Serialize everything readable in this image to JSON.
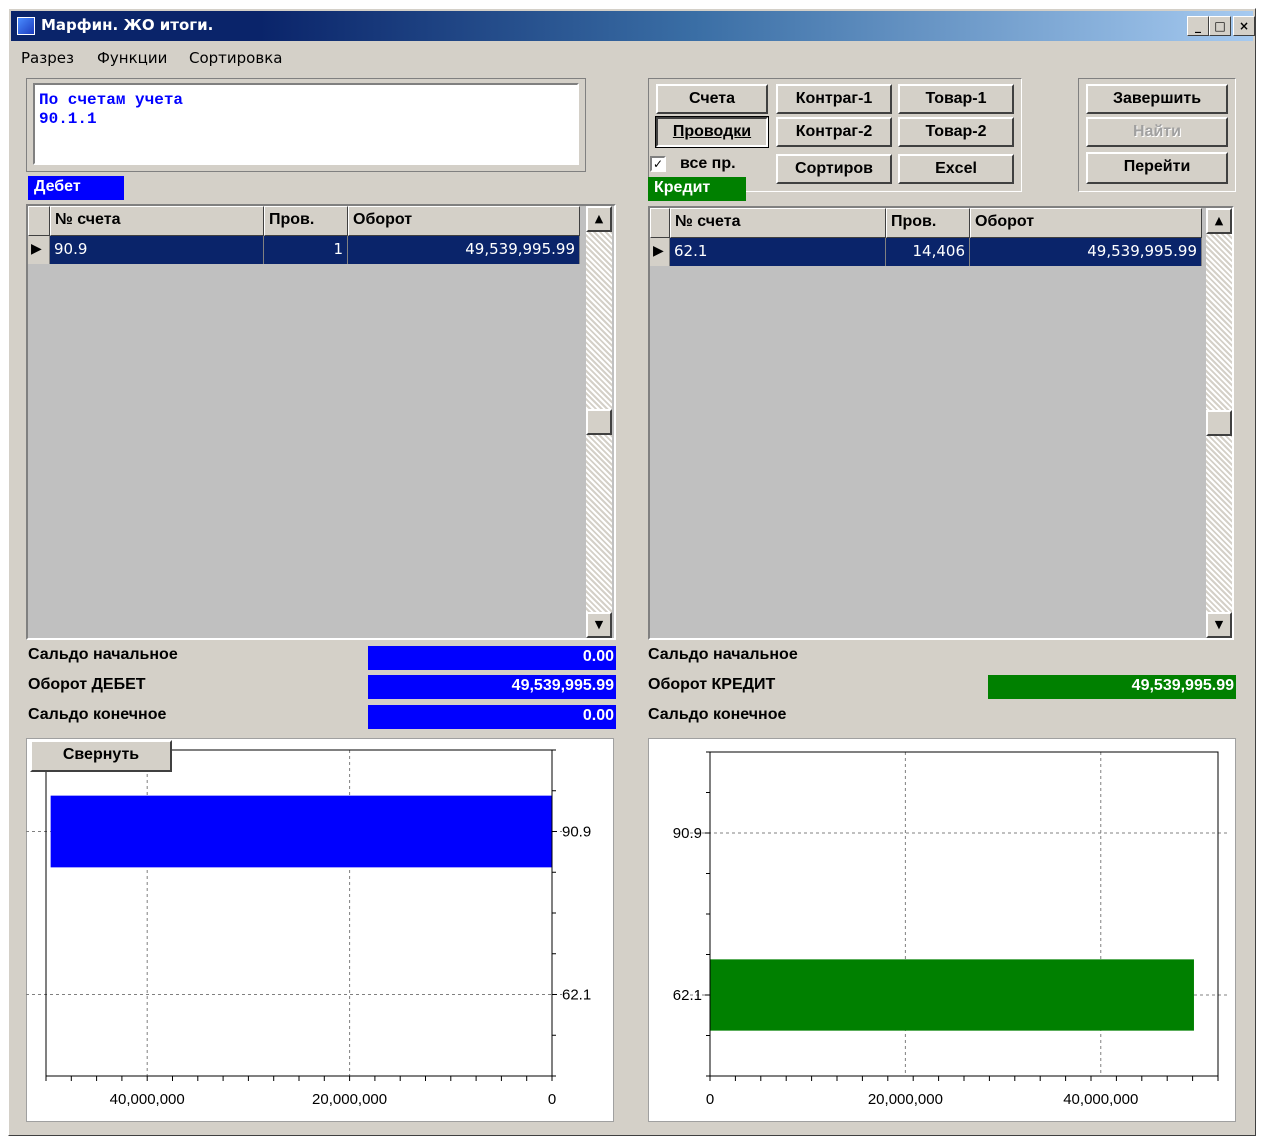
{
  "window": {
    "title": "Марфин. ЖО итоги.",
    "controls": {
      "minimize": "_",
      "maximize": "□",
      "close": "×"
    }
  },
  "menu": [
    "Разрез",
    "Функции",
    "Сортировка"
  ],
  "info_box": {
    "line1": "По счетам учета",
    "line2": "90.1.1"
  },
  "buttons": {
    "accounts": "Счета",
    "postings": "Проводки",
    "counterparty1": "Контраг-1",
    "counterparty2": "Контраг-2",
    "goods1": "Товар-1",
    "goods2": "Товар-2",
    "sort": "Сортиров",
    "excel": "Excel",
    "finish": "Завершить",
    "find": "Найти",
    "goto": "Перейти"
  },
  "checkbox": {
    "label": "все пр.",
    "checked": true,
    "mark": "✓"
  },
  "debit": {
    "caption": "Дебет",
    "color": "#0000ff",
    "columns": [
      "№ счета",
      "Пров.",
      "Оборот"
    ],
    "rows": [
      {
        "account": "90.9",
        "count": "1",
        "turnover": "49,539,995.99"
      }
    ],
    "summary": [
      {
        "label": "Сальдо начальное",
        "value": "0.00"
      },
      {
        "label": "Оборот ДЕБЕТ",
        "value": "49,539,995.99"
      },
      {
        "label": "Сальдо конечное",
        "value": "0.00"
      }
    ],
    "collapse_button": "Свернуть"
  },
  "credit": {
    "caption": "Кредит",
    "color": "#008000",
    "columns": [
      "№ счета",
      "Пров.",
      "Оборот"
    ],
    "rows": [
      {
        "account": "62.1",
        "count": "14,406",
        "turnover": "49,539,995.99"
      }
    ],
    "summary": [
      {
        "label": "Сальдо начальное",
        "value": ""
      },
      {
        "label": "Оборот КРЕДИТ",
        "value": "49,539,995.99"
      },
      {
        "label": "Сальдо конечное",
        "value": ""
      }
    ]
  },
  "chart_data": [
    {
      "type": "bar",
      "orientation": "horizontal",
      "direction": "reversed",
      "categories": [
        "90.9",
        "62.1"
      ],
      "series": [
        {
          "values": [
            49539995.99,
            0
          ],
          "color": "#0000ff"
        }
      ],
      "xlim": [
        0,
        50000000
      ],
      "xticks": [
        "40,000,000",
        "20,000,000",
        "0"
      ],
      "tick_values": [
        40000000,
        20000000,
        0
      ],
      "category_axis": "right",
      "grid": true
    },
    {
      "type": "bar",
      "orientation": "horizontal",
      "direction": "normal",
      "categories": [
        "90.9",
        "62.1"
      ],
      "series": [
        {
          "values": [
            0,
            49539995.99
          ],
          "color": "#008000"
        }
      ],
      "xlim": [
        0,
        52000000
      ],
      "xticks": [
        "0",
        "20,000,000",
        "40,000,000"
      ],
      "tick_values": [
        0,
        20000000,
        40000000
      ],
      "category_axis": "left",
      "grid": true
    }
  ]
}
